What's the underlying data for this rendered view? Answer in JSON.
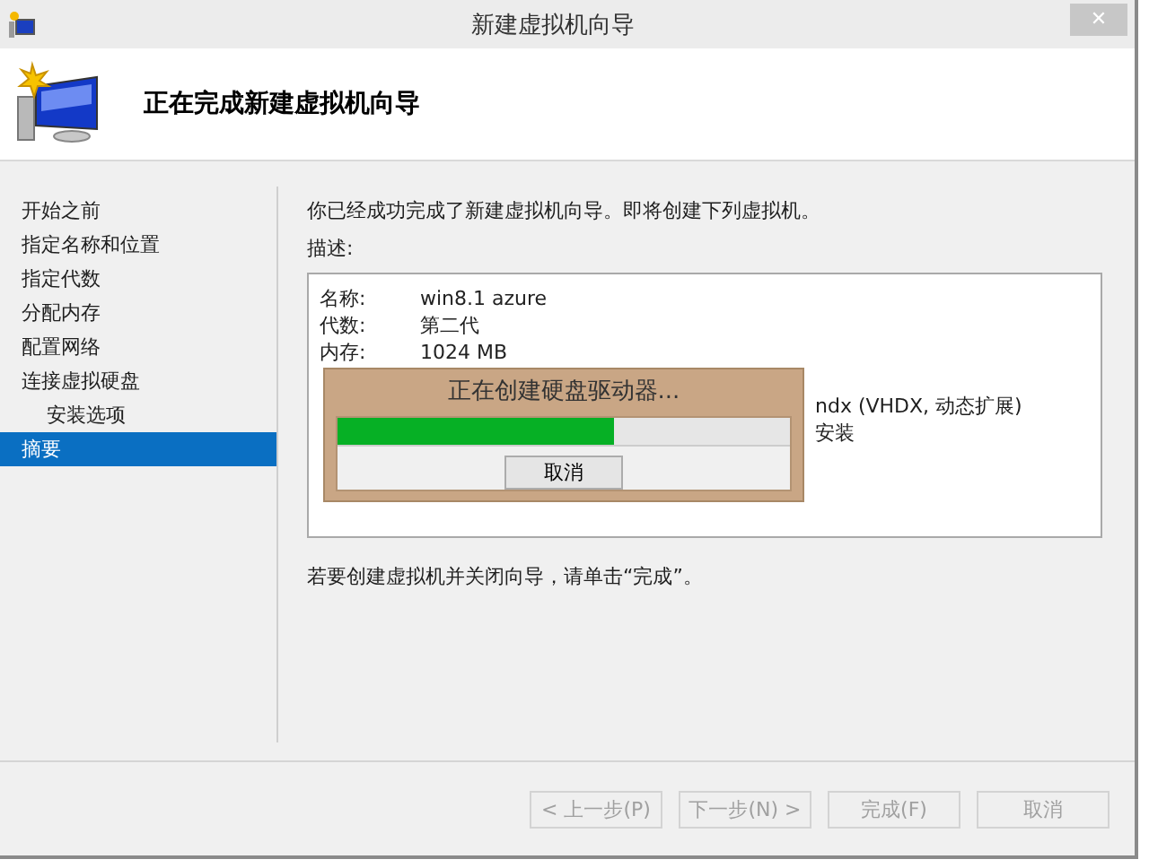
{
  "window": {
    "title": "新建虚拟机向导",
    "close": "✕"
  },
  "header": {
    "title": "正在完成新建虚拟机向导"
  },
  "sidebar": {
    "items": [
      {
        "label": "开始之前",
        "selected": false
      },
      {
        "label": "指定名称和位置",
        "selected": false
      },
      {
        "label": "指定代数",
        "selected": false
      },
      {
        "label": "分配内存",
        "selected": false
      },
      {
        "label": "配置网络",
        "selected": false
      },
      {
        "label": "连接虚拟硬盘",
        "selected": false,
        "children": [
          {
            "label": "安装选项",
            "selected": false
          }
        ]
      },
      {
        "label": "摘要",
        "selected": true
      }
    ]
  },
  "intro": "你已经成功完成了新建虚拟机向导。即将创建下列虚拟机。",
  "description_label": "描述:",
  "description": [
    {
      "kind": "full",
      "label": "名称:",
      "value": "win8.1 azure"
    },
    {
      "kind": "full",
      "label": "代数:",
      "value": "第二代"
    },
    {
      "kind": "full",
      "label": "内存:",
      "value": "1024 MB"
    },
    {
      "kind": "hidden"
    },
    {
      "kind": "tail",
      "value": "ndx (VHDX, 动态扩展)"
    },
    {
      "kind": "tail",
      "value": "安装"
    }
  ],
  "progress_dialog": {
    "title": "正在创建硬盘驱动器...",
    "level": 0.61,
    "cancel": "取消"
  },
  "footer_note": "若要创建虚拟机并关闭向导，请单击“完成”。",
  "buttons": [
    {
      "label": "< 上一步(P)",
      "disabled": true
    },
    {
      "label": "下一步(N) >",
      "disabled": true
    },
    {
      "label": "完成(F)",
      "disabled": true
    },
    {
      "label": "取消",
      "disabled": true
    }
  ]
}
